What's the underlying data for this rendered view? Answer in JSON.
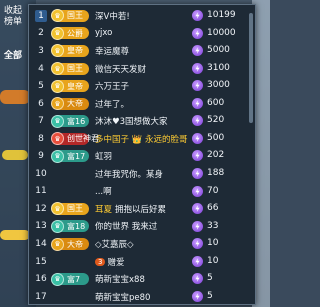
{
  "sidebar": {
    "title_line1": "收起",
    "title_line2": "榜单",
    "tab_all": "全部"
  },
  "rows": [
    {
      "rank": "1",
      "badge": "国王",
      "badge_color": "#e8a41c",
      "gem_color": "#f2c230",
      "name": "深V中若!",
      "value": "10199",
      "is_first": true
    },
    {
      "rank": "2",
      "badge": "公爵",
      "badge_color": "#e8a41c",
      "gem_color": "#f2c230",
      "name": "yjxo",
      "value": "10000"
    },
    {
      "rank": "3",
      "badge": "皇帝",
      "badge_color": "#e8a41c",
      "gem_color": "#f2c230",
      "name": "幸运魔尊",
      "value": "5000"
    },
    {
      "rank": "4",
      "badge": "国王",
      "badge_color": "#e8a41c",
      "gem_color": "#f2c230",
      "name": "微信天天发财",
      "value": "3100"
    },
    {
      "rank": "5",
      "badge": "皇帝",
      "badge_color": "#e8a41c",
      "gem_color": "#f2c230",
      "name": "六万王子",
      "value": "3000"
    },
    {
      "rank": "6",
      "badge": "大帝",
      "badge_color": "#d98a10",
      "gem_color": "#e8a41c",
      "name": "过年了。",
      "value": "600"
    },
    {
      "rank": "7",
      "badge": "富16",
      "badge_color": "#2c9a8a",
      "gem_color": "#3ac0a6",
      "name": "沐沐♥3国想做大家",
      "value": "520"
    },
    {
      "rank": "8",
      "badge": "创世神君",
      "badge_color": "#b32828",
      "gem_color": "#e84e3c",
      "name": "多中国子 👑 永远的脸哥",
      "value": "500",
      "highlight": true
    },
    {
      "rank": "9",
      "badge": "富17",
      "badge_color": "#2c9a8a",
      "gem_color": "#3ac0a6",
      "name": "虹羽",
      "value": "202"
    },
    {
      "rank": "10",
      "badge": "",
      "badge_color": "",
      "gem_color": "",
      "name": "过年我咒你。某身",
      "value": "188"
    },
    {
      "rank": "11",
      "badge": "",
      "badge_color": "",
      "gem_color": "",
      "name": "...啊",
      "value": "70"
    },
    {
      "rank": "12",
      "badge": "国王",
      "badge_color": "#e8a41c",
      "gem_color": "#f2c230",
      "name": "拥抱以后好累",
      "value": "66",
      "name_prefix": "耳夏",
      "prefix_color": "#ffcc33"
    },
    {
      "rank": "13",
      "badge": "富18",
      "badge_color": "#2c9a8a",
      "gem_color": "#3ac0a6",
      "name": "你的世界 我来过",
      "value": "33"
    },
    {
      "rank": "14",
      "badge": "大帝",
      "badge_color": "#d98a10",
      "gem_color": "#e8a41c",
      "name": "◇艾嘉辰◇",
      "value": "10"
    },
    {
      "rank": "15",
      "badge": "",
      "badge_color": "",
      "gem_color": "",
      "name": "赠爱",
      "value": "10",
      "inline_badge": "3"
    },
    {
      "rank": "16",
      "badge": "富7",
      "badge_color": "#2c9a8a",
      "gem_color": "#3ac0a6",
      "name": "萌新宝宝x88",
      "value": "5"
    },
    {
      "rank": "17",
      "badge": "",
      "badge_color": "",
      "gem_color": "",
      "name": "萌新宝宝pe80",
      "value": "5"
    }
  ]
}
